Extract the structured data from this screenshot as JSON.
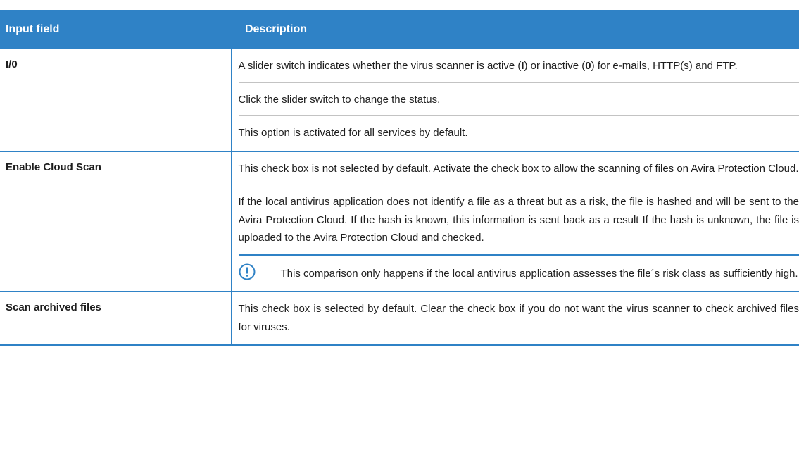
{
  "table": {
    "headers": [
      "Input field",
      "Description"
    ],
    "rows": [
      {
        "field": "I/0",
        "paragraphs": [
          {
            "segments": [
              "A slider switch indicates whether the virus scanner is active (",
              "I",
              ") or inactive (",
              "0",
              ") for e-mails, HTTP(s) and FTP."
            ]
          },
          {
            "text": "Click the slider switch to change the status."
          },
          {
            "text": "This option is activated for all services by default."
          }
        ]
      },
      {
        "field": "Enable Cloud Scan",
        "paragraphs": [
          {
            "text": "This check box is not selected by default. Activate the check box to allow the scanning of files on Avira Protection Cloud."
          },
          {
            "text": "If the local antivirus application does not identify a file as a threat but as a risk, the file is hashed and will be sent to the Avira Protection Cloud. If the hash is known, this information is sent back as a result If the hash is unknown, the file is uploaded to the Avira Protection Cloud and checked."
          }
        ],
        "note": {
          "icon": "exclamation-circle-icon",
          "text": "This comparison only happens if the local antivirus application assesses the file´s risk class as sufficiently high."
        }
      },
      {
        "field": "Scan archived files",
        "paragraphs": [
          {
            "text": "This check box is selected by default. Clear the check box if you do not want the virus scanner to check archived files for viruses."
          }
        ]
      }
    ]
  },
  "colors": {
    "accent": "#2f82c6",
    "divider": "#c3c3c3",
    "text": "#1e1e1e"
  }
}
